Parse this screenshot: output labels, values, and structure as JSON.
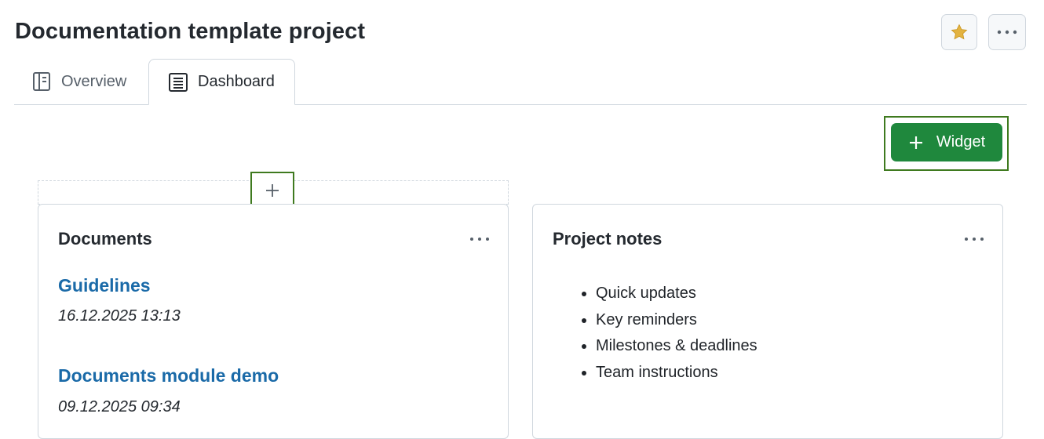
{
  "page": {
    "title": "Documentation template project",
    "favorite_icon": "star-icon",
    "more_icon": "kebab-horizontal-icon"
  },
  "tabs": [
    {
      "label": "Overview",
      "icon": "book-icon",
      "selected": false
    },
    {
      "label": "Dashboard",
      "icon": "list-icon",
      "selected": true
    }
  ],
  "toolbar": {
    "add_widget_label": "Widget",
    "add_widget_icon": "plus-icon"
  },
  "documents_card": {
    "title": "Documents",
    "items": [
      {
        "name": "Guidelines",
        "date": "16.12.2025 13:13"
      },
      {
        "name": "Documents module demo",
        "date": "09.12.2025 09:34"
      }
    ]
  },
  "notes_card": {
    "title": "Project notes",
    "items": [
      "Quick updates",
      "Key reminders",
      "Milestones & deadlines",
      "Team instructions"
    ]
  },
  "colors": {
    "primary_button": "#1f883d",
    "link": "#1a6aa8",
    "highlight_outline": "#3f7a1f",
    "star": "#e3b341"
  }
}
